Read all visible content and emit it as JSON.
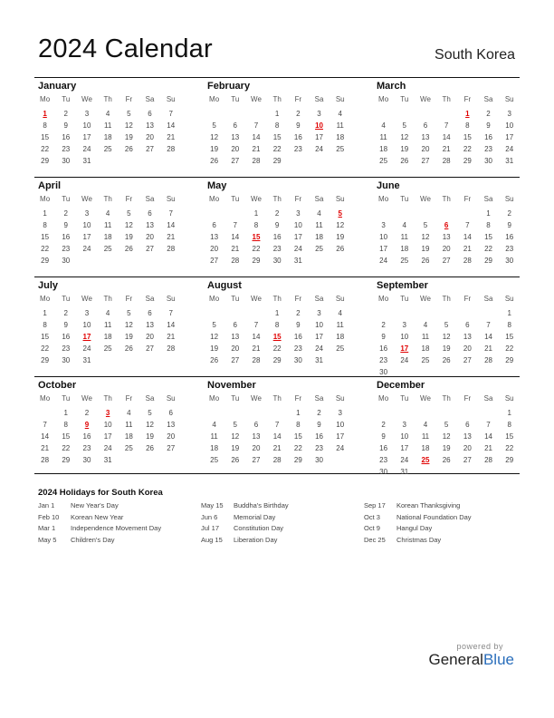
{
  "header": {
    "title": "2024 Calendar",
    "country": "South Korea"
  },
  "weekdays": [
    "Mo",
    "Tu",
    "We",
    "Th",
    "Fr",
    "Sa",
    "Su"
  ],
  "colors": {
    "holiday": "#e00000",
    "brand_blue": "#2a6ebb"
  },
  "months": [
    {
      "name": "January",
      "offset": 0,
      "days": 31,
      "holidays": [
        1
      ]
    },
    {
      "name": "February",
      "offset": 3,
      "days": 29,
      "holidays": [
        10
      ]
    },
    {
      "name": "March",
      "offset": 4,
      "days": 31,
      "holidays": [
        1
      ]
    },
    {
      "name": "April",
      "offset": 0,
      "days": 30,
      "holidays": []
    },
    {
      "name": "May",
      "offset": 2,
      "days": 31,
      "holidays": [
        5,
        15
      ]
    },
    {
      "name": "June",
      "offset": 5,
      "days": 30,
      "holidays": [
        6
      ]
    },
    {
      "name": "July",
      "offset": 0,
      "days": 31,
      "holidays": [
        17
      ]
    },
    {
      "name": "August",
      "offset": 3,
      "days": 31,
      "holidays": [
        15
      ]
    },
    {
      "name": "September",
      "offset": 6,
      "days": 30,
      "holidays": [
        17
      ]
    },
    {
      "name": "October",
      "offset": 1,
      "days": 31,
      "holidays": [
        3,
        9
      ]
    },
    {
      "name": "November",
      "offset": 4,
      "days": 30,
      "holidays": []
    },
    {
      "name": "December",
      "offset": 6,
      "days": 31,
      "holidays": [
        25
      ]
    }
  ],
  "holidays": {
    "title": "2024 Holidays for South Korea",
    "columns": [
      [
        {
          "date": "Jan 1",
          "name": "New Year's Day"
        },
        {
          "date": "Feb 10",
          "name": "Korean New Year"
        },
        {
          "date": "Mar 1",
          "name": "Independence Movement Day"
        },
        {
          "date": "May 5",
          "name": "Children's Day"
        }
      ],
      [
        {
          "date": "May 15",
          "name": "Buddha's Birthday"
        },
        {
          "date": "Jun 6",
          "name": "Memorial Day"
        },
        {
          "date": "Jul 17",
          "name": "Constitution Day"
        },
        {
          "date": "Aug 15",
          "name": "Liberation Day"
        }
      ],
      [
        {
          "date": "Sep 17",
          "name": "Korean Thanksgiving"
        },
        {
          "date": "Oct 3",
          "name": "National Foundation Day"
        },
        {
          "date": "Oct 9",
          "name": "Hangul Day"
        },
        {
          "date": "Dec 25",
          "name": "Christmas Day"
        }
      ]
    ]
  },
  "footer": {
    "powered_by": "powered by",
    "brand_part1": "General",
    "brand_part2": "Blue"
  }
}
